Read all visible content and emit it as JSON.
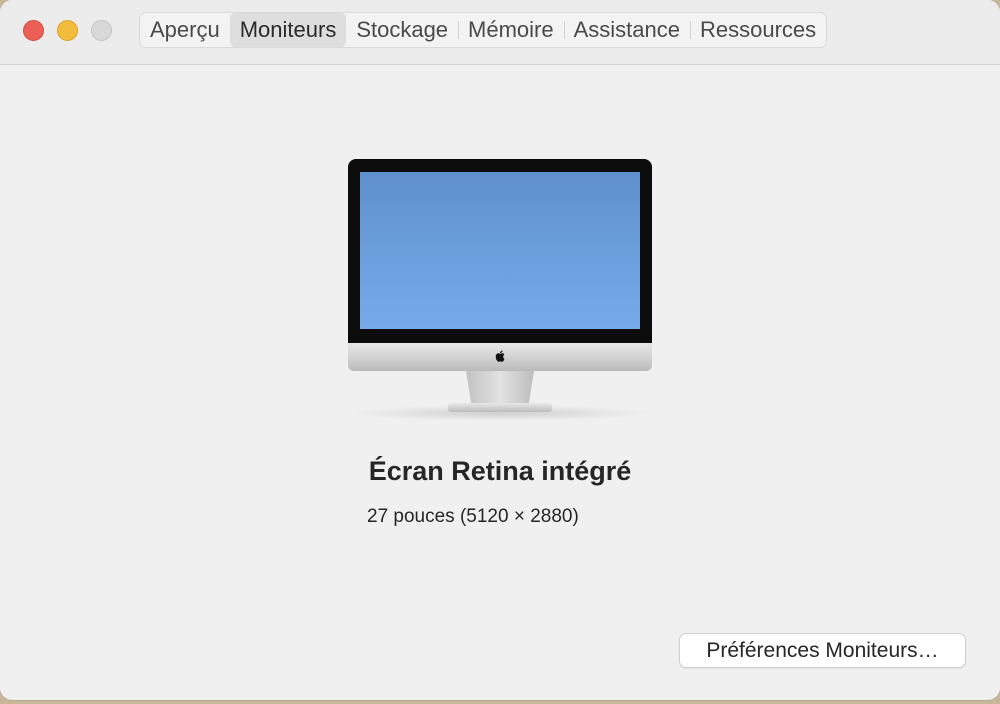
{
  "window": {
    "tabs": [
      {
        "label": "Aperçu",
        "active": false
      },
      {
        "label": "Moniteurs",
        "active": true
      },
      {
        "label": "Stockage",
        "active": false
      },
      {
        "label": "Mémoire",
        "active": false
      },
      {
        "label": "Assistance",
        "active": false
      },
      {
        "label": "Ressources",
        "active": false
      }
    ]
  },
  "display": {
    "name": "Écran Retina intégré",
    "details": "27 pouces (5120 × 2880)"
  },
  "actions": {
    "preferences_label": "Préférences Moniteurs…"
  },
  "colors": {
    "close": "#ec5f57",
    "minimize": "#f4bc3c",
    "zoom": "#d8d8d8",
    "screen": "#6c9fdd"
  },
  "icons": {
    "logo": "apple-logo-icon"
  }
}
